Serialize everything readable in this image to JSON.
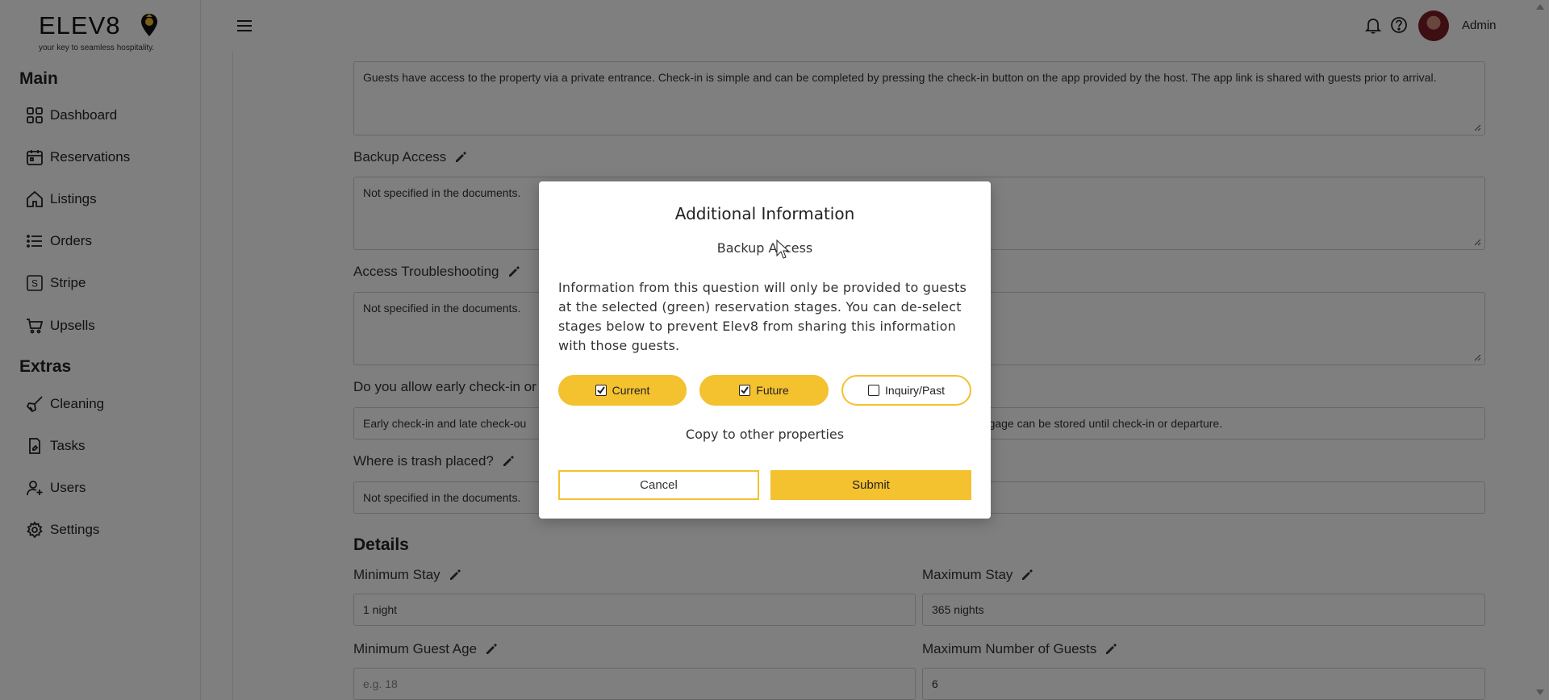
{
  "brand": {
    "name": "ELEV8",
    "tagline": "your key to seamless hospitality."
  },
  "sidebar": {
    "sections": [
      {
        "title": "Main",
        "items": [
          {
            "label": "Dashboard",
            "icon": "grid-icon"
          },
          {
            "label": "Reservations",
            "icon": "calendar-icon"
          },
          {
            "label": "Listings",
            "icon": "home-icon"
          },
          {
            "label": "Orders",
            "icon": "list-icon"
          },
          {
            "label": "Stripe",
            "icon": "stripe-icon"
          },
          {
            "label": "Upsells",
            "icon": "cart-icon"
          }
        ]
      },
      {
        "title": "Extras",
        "items": [
          {
            "label": "Cleaning",
            "icon": "broom-icon"
          },
          {
            "label": "Tasks",
            "icon": "clipboard-icon"
          },
          {
            "label": "Users",
            "icon": "user-plus-icon"
          },
          {
            "label": "Settings",
            "icon": "gear-icon"
          }
        ]
      }
    ]
  },
  "header": {
    "user": "Admin"
  },
  "form": {
    "checkin_text": "Guests have access to the property via a private entrance. Check-in is simple and can be completed by pressing the check-in button on the app provided by the host. The app link is shared with guests prior to arrival.",
    "backup_access": {
      "label": "Backup Access",
      "value": "Not specified in the documents."
    },
    "access_troubleshooting": {
      "label": "Access Troubleshooting",
      "value": "Not specified in the documents."
    },
    "early_checkin": {
      "label": "Do you allow early check-in or",
      "value_left": "Early check-in and late check-ou",
      "value_right": "aggage can be stored until check-in or departure."
    },
    "trash": {
      "label": "Where is trash placed?",
      "value": "Not specified in the documents."
    },
    "details_title": "Details",
    "min_stay": {
      "label": "Minimum Stay",
      "value": "1 night"
    },
    "max_stay": {
      "label": "Maximum Stay",
      "value": "365 nights"
    },
    "min_age": {
      "label": "Minimum Guest Age",
      "placeholder": "e.g. 18"
    },
    "max_guests": {
      "label": "Maximum Number of Guests",
      "value": "6"
    }
  },
  "modal": {
    "title": "Additional Information",
    "subtitle": "Backup Access",
    "body": "Information from this question will only be provided to guests at the selected (green) reservation stages. You can de-select stages below to prevent Elev8 from sharing this information with those guests.",
    "stages": [
      {
        "label": "Current",
        "checked": true
      },
      {
        "label": "Future",
        "checked": true
      },
      {
        "label": "Inquiry/Past",
        "checked": false
      }
    ],
    "copy_label": "Copy to other properties",
    "cancel_label": "Cancel",
    "submit_label": "Submit"
  },
  "colors": {
    "accent": "#f4c12f",
    "overlay": "rgba(0,0,0,0.5)"
  }
}
